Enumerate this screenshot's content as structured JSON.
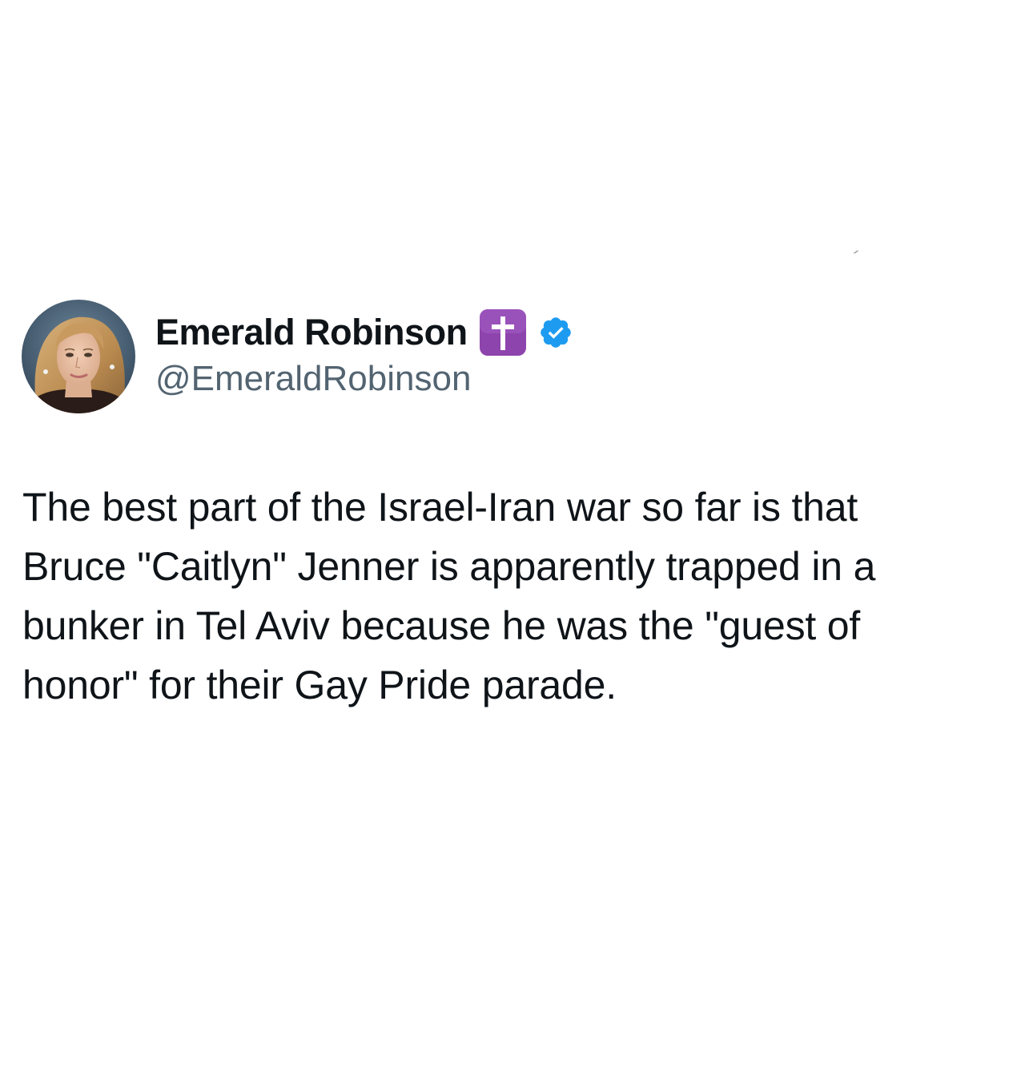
{
  "tweet": {
    "author": {
      "display_name": "Emerald Robinson",
      "handle": "@EmeraldRobinson",
      "name_emoji": "latin-cross-emoji",
      "verified": true,
      "verified_badge_color": "#1d9bf0",
      "cross_emoji_color": "#8e44ad"
    },
    "text_lines": [
      "The best part of the Israel-Iran war so far is that",
      "Bruce \"Caitlyn\" Jenner is apparently trapped in a",
      "bunker in Tel Aviv because he was the \"guest of",
      "honor\" for their Gay Pride parade."
    ]
  },
  "colors": {
    "background": "#ffffff",
    "primary_text": "#0f1419",
    "secondary_text": "#536471"
  }
}
